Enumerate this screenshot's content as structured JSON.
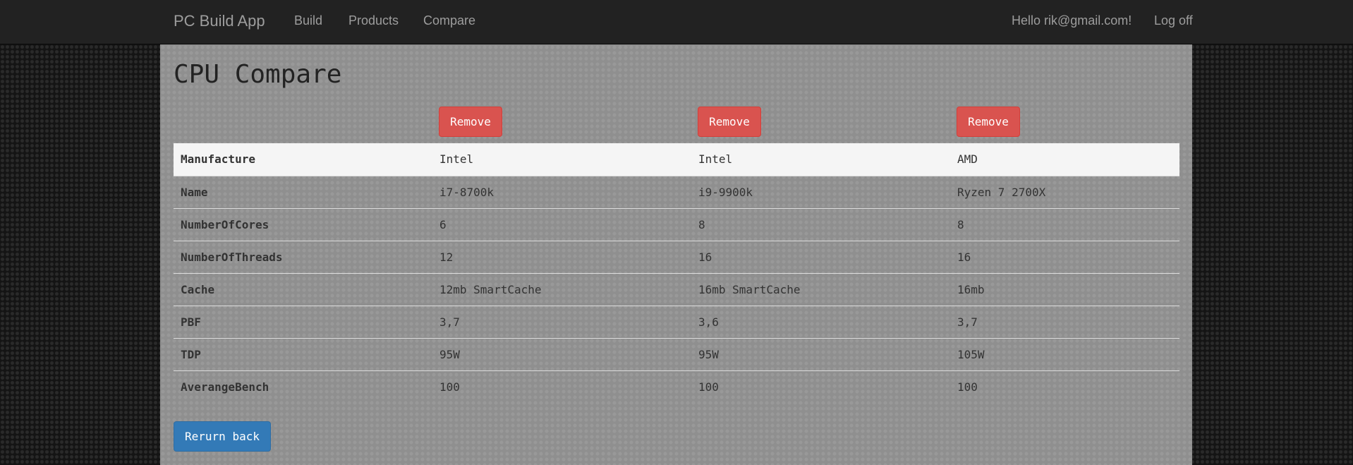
{
  "nav": {
    "brand": "PC Build App",
    "links": [
      "Build",
      "Products",
      "Compare"
    ],
    "greeting": "Hello rik@gmail.com!",
    "logoff": "Log off"
  },
  "page": {
    "title": "CPU Compare",
    "remove_label": "Remove",
    "back_label": "Rerurn back"
  },
  "table": {
    "rows": [
      {
        "label": "Manufacture",
        "values": [
          "Intel",
          "Intel",
          "AMD"
        ]
      },
      {
        "label": "Name",
        "values": [
          "i7-8700k",
          "i9-9900k",
          "Ryzen 7 2700X"
        ]
      },
      {
        "label": "NumberOfCores",
        "values": [
          "6",
          "8",
          "8"
        ]
      },
      {
        "label": "NumberOfThreads",
        "values": [
          "12",
          "16",
          "16"
        ]
      },
      {
        "label": "Cache",
        "values": [
          "12mb SmartCache",
          "16mb SmartCache",
          "16mb"
        ]
      },
      {
        "label": "PBF",
        "values": [
          "3,7",
          "3,6",
          "3,7"
        ]
      },
      {
        "label": "TDP",
        "values": [
          "95W",
          "95W",
          "105W"
        ]
      },
      {
        "label": "AverangeBench",
        "values": [
          "100",
          "100",
          "100"
        ]
      }
    ]
  },
  "colors": {
    "navbar": "#222222",
    "danger": "#d9534f",
    "primary": "#337ab7",
    "panel": "#8f8f8f"
  }
}
